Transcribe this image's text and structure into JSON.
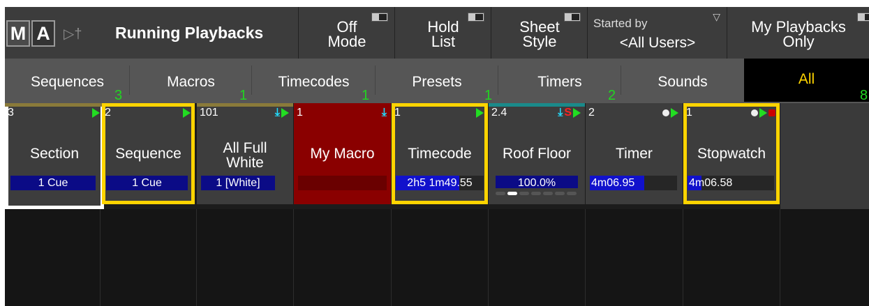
{
  "header": {
    "logo": [
      "M",
      "A"
    ],
    "pin_icon": "pin-icon",
    "title": "Running Playbacks",
    "buttons": [
      {
        "line1": "Off",
        "line2": "Mode"
      },
      {
        "line1": "Hold",
        "line2": "List"
      },
      {
        "line1": "Sheet",
        "line2": "Style"
      }
    ],
    "started_by": {
      "label": "Started by",
      "value": "<All Users>"
    },
    "my_playbacks": {
      "line1": "My Playbacks",
      "line2": "Only"
    }
  },
  "tabs": [
    {
      "label": "Sequences",
      "count": "3"
    },
    {
      "label": "Macros",
      "count": "1"
    },
    {
      "label": "Timecodes",
      "count": "1"
    },
    {
      "label": "Presets",
      "count": "1"
    },
    {
      "label": "Timers",
      "count": "2"
    },
    {
      "label": "Sounds",
      "count": ""
    },
    {
      "label": "All",
      "count": "8"
    }
  ],
  "tiles": [
    {
      "num": "3",
      "name": "Section",
      "bar": "1 Cue"
    },
    {
      "num": "2",
      "name": "Sequence",
      "bar": "1 Cue"
    },
    {
      "num": "101",
      "name1": "All Full",
      "name2": "White",
      "bar": "1 [White]"
    },
    {
      "num": "1",
      "name": "My Macro",
      "bar": ""
    },
    {
      "num": "1",
      "name": "Timecode",
      "bar": "2h5 1m49.55"
    },
    {
      "num": "2.4",
      "name": "Roof Floor",
      "bar": "100.0%"
    },
    {
      "num": "2",
      "name": "Timer",
      "bar": "4m06.95"
    },
    {
      "num": "1",
      "name": "Stopwatch",
      "bar": "4m06.58"
    }
  ],
  "colors": {
    "accent": "#ffd400",
    "active": "#22dd22",
    "macro": "#8a0000",
    "bar": "#0b0b86"
  }
}
